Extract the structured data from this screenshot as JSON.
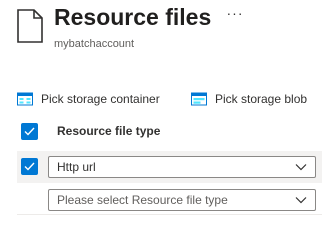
{
  "header": {
    "title": "Resource files",
    "subtitle": "mybatchaccount",
    "more_label": "···",
    "page_icon": "document-icon",
    "more_icon": "more-icon"
  },
  "toolbar": {
    "pick_container_label": "Pick storage container",
    "pick_container_icon": "storage-container-icon",
    "pick_blob_label": "Pick storage blob",
    "pick_blob_icon": "storage-blob-icon"
  },
  "table": {
    "column_header": "Resource file type",
    "header_checked": true,
    "rows": [
      {
        "checked": true,
        "value": "Http url",
        "placeholder": ""
      },
      {
        "checked": false,
        "value": "",
        "placeholder": "Please select Resource file type"
      }
    ]
  },
  "colors": {
    "accent": "#0078d4",
    "row_selected_bg": "#f3f2f1",
    "border": "#8a8886",
    "text": "#323130",
    "muted_text": "#605e5c",
    "storage_icon_blue": "#50e6ff"
  }
}
